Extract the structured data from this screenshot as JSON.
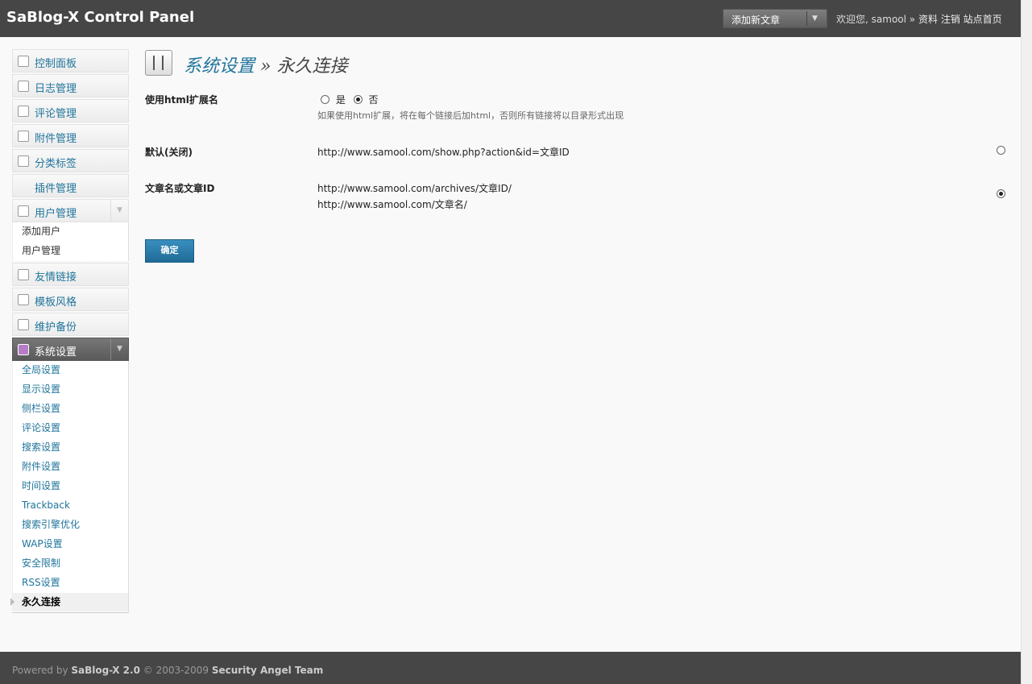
{
  "header": {
    "title": "SaBlog-X Control Panel",
    "quick_add": "添加新文章",
    "welcome_prefix": "欢迎您,",
    "username": "samool",
    "raquo": "»",
    "profile": "资料",
    "logout": "注销",
    "site_home": "站点首页"
  },
  "sidebar": {
    "items": [
      {
        "label": "控制面板",
        "icon": "home-icon"
      },
      {
        "label": "日志管理",
        "icon": "posts-icon"
      },
      {
        "label": "评论管理",
        "icon": "comment-icon"
      },
      {
        "label": "附件管理",
        "icon": "attachment-icon"
      },
      {
        "label": "分类标签",
        "icon": "pin-icon"
      },
      {
        "label": "插件管理",
        "icon": ""
      },
      {
        "label": "用户管理",
        "icon": "users-icon"
      },
      {
        "label": "友情链接",
        "icon": "link-icon"
      },
      {
        "label": "模板风格",
        "icon": "theme-icon"
      },
      {
        "label": "维护备份",
        "icon": "tools-icon"
      },
      {
        "label": "系统设置",
        "icon": "settings-icon"
      }
    ],
    "user_sub": [
      "添加用户",
      "用户管理"
    ],
    "settings_sub": [
      "全局设置",
      "显示设置",
      "侧栏设置",
      "评论设置",
      "搜索设置",
      "附件设置",
      "时间设置",
      "Trackback",
      "搜索引擎优化",
      "WAP设置",
      "安全限制",
      "RSS设置",
      "永久连接"
    ]
  },
  "main": {
    "crumb": "系统设置",
    "sep": "»",
    "title": "永久连接",
    "html_ext": {
      "label": "使用html扩展名",
      "yes": "是",
      "no": "否",
      "selected": "no",
      "hint": "如果使用html扩展，将在每个链接后加html，否则所有链接将以目录形式出现"
    },
    "default": {
      "label": "默认(关闭)",
      "url": "http://www.samool.com/show.php?action&id=文章ID",
      "selected": false
    },
    "named": {
      "label": "文章名或文章ID",
      "url1": "http://www.samool.com/archives/文章ID/",
      "url2": "http://www.samool.com/文章名/",
      "selected": true
    },
    "submit": "确定"
  },
  "footer": {
    "powered": "Powered by",
    "product": "SaBlog-X 2.0",
    "copy": "© 2003-2009",
    "team": "Security Angel Team"
  },
  "colors": {
    "header_bg": "#464646",
    "link": "#21759b",
    "button": "#2a7fb0"
  }
}
